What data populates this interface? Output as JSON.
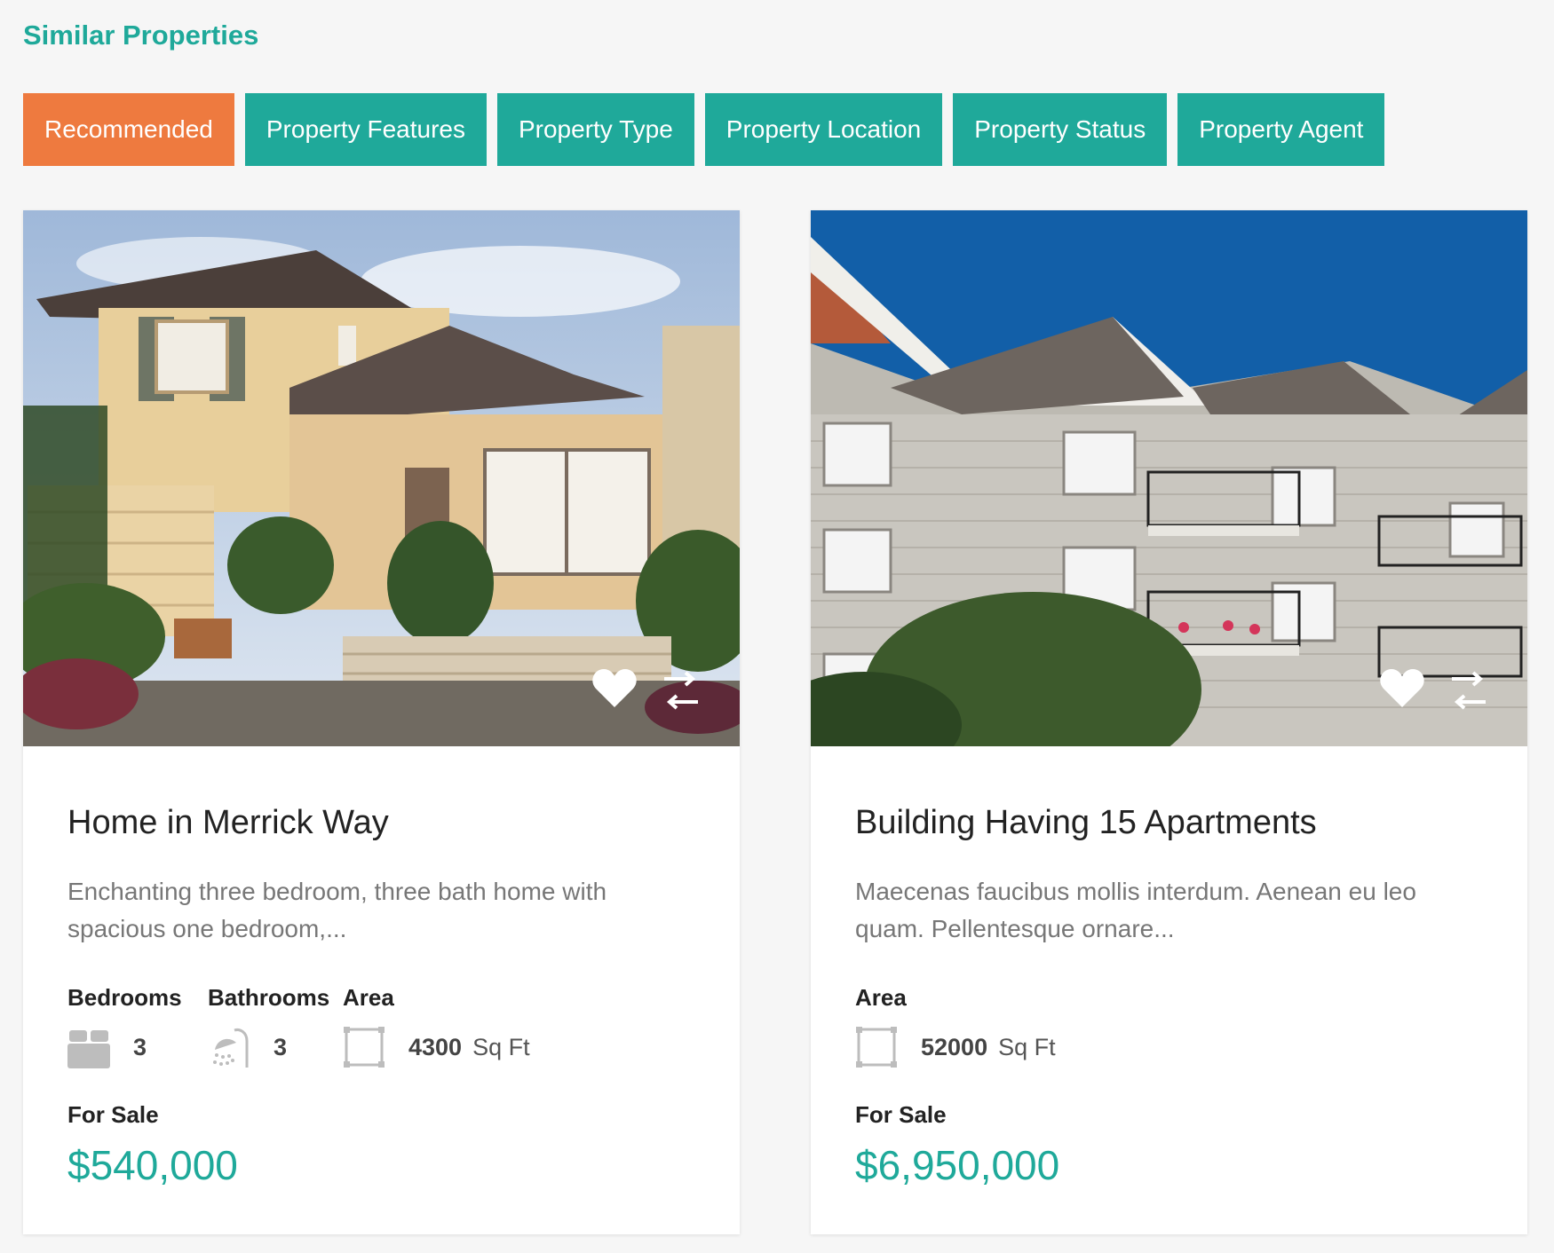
{
  "section": {
    "title": "Similar Properties"
  },
  "tabs": [
    {
      "label": "Recommended",
      "active": true
    },
    {
      "label": "Property Features"
    },
    {
      "label": "Property Type"
    },
    {
      "label": "Property Location"
    },
    {
      "label": "Property Status"
    },
    {
      "label": "Property Agent"
    }
  ],
  "colors": {
    "accent": "#1fa99a",
    "active_tab": "#ee7a3f"
  },
  "cards": [
    {
      "title": "Home in Merrick Way",
      "description": "Enchanting three bedroom, three bath home with spacious one bedroom,...",
      "features": {
        "bedrooms": {
          "label": "Bedrooms",
          "value": "3",
          "icon": "bed-icon"
        },
        "bathrooms": {
          "label": "Bathrooms",
          "value": "3",
          "icon": "shower-icon"
        },
        "area": {
          "label": "Area",
          "value": "4300",
          "unit": "Sq Ft",
          "icon": "area-icon"
        }
      },
      "status": "For Sale",
      "price": "$540,000"
    },
    {
      "title": "Building Having 15 Apartments",
      "description": "Maecenas faucibus mollis interdum. Aenean eu leo quam. Pellentesque ornare...",
      "features": {
        "area": {
          "label": "Area",
          "value": "52000",
          "unit": "Sq Ft",
          "icon": "area-icon"
        }
      },
      "status": "For Sale",
      "price": "$6,950,000"
    }
  ]
}
